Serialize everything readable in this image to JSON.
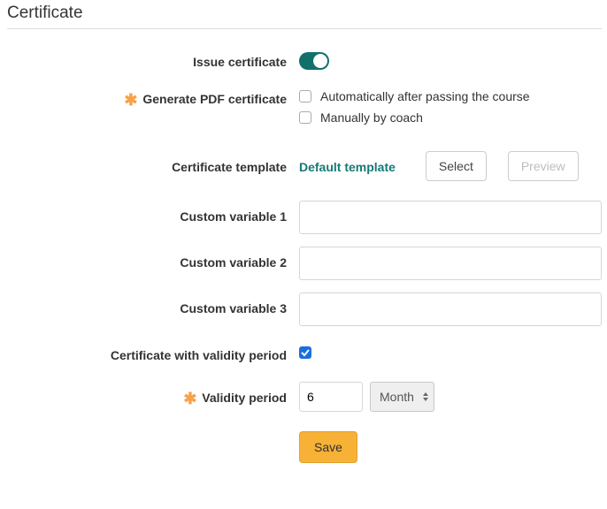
{
  "title": "Certificate",
  "fields": {
    "issue_certificate": {
      "label": "Issue certificate",
      "on": true
    },
    "generate_pdf": {
      "label": "Generate PDF certificate",
      "options": {
        "auto": {
          "label": "Automatically after passing the course",
          "checked": false
        },
        "manual": {
          "label": "Manually by coach",
          "checked": false
        }
      }
    },
    "template": {
      "label": "Certificate template",
      "value": "Default template",
      "select_btn": "Select",
      "preview_btn": "Preview"
    },
    "custom1": {
      "label": "Custom variable 1",
      "value": ""
    },
    "custom2": {
      "label": "Custom variable 2",
      "value": ""
    },
    "custom3": {
      "label": "Custom variable 3",
      "value": ""
    },
    "validity_enabled": {
      "label": "Certificate with validity period",
      "checked": true
    },
    "validity_period": {
      "label": "Validity period",
      "value": "6",
      "unit": "Month"
    }
  },
  "actions": {
    "save": "Save"
  },
  "colors": {
    "accent": "#12706b",
    "star": "#f7a24a",
    "primary_btn": "#f7b136"
  }
}
